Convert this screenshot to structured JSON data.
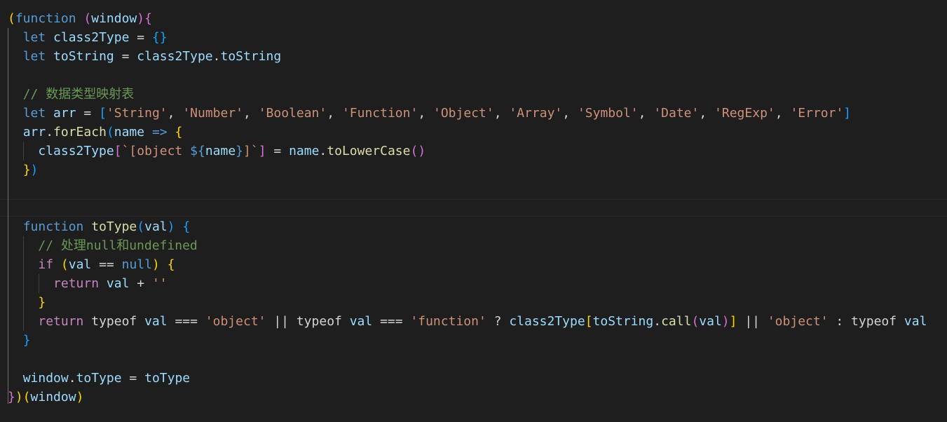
{
  "editor": {
    "lines": [
      [
        [
          "b1",
          "("
        ],
        [
          "kw",
          "function"
        ],
        [
          "op",
          " "
        ],
        [
          "b2",
          "("
        ],
        [
          "var",
          "window"
        ],
        [
          "b2",
          ")"
        ],
        [
          "b2",
          "{"
        ]
      ],
      [
        [
          "op",
          "  "
        ],
        [
          "kw",
          "let"
        ],
        [
          "op",
          " "
        ],
        [
          "var",
          "class2Type"
        ],
        [
          "op",
          " = "
        ],
        [
          "b3",
          "{}"
        ]
      ],
      [
        [
          "op",
          "  "
        ],
        [
          "kw",
          "let"
        ],
        [
          "op",
          " "
        ],
        [
          "var",
          "toString"
        ],
        [
          "op",
          " = "
        ],
        [
          "var",
          "class2Type"
        ],
        [
          "op",
          "."
        ],
        [
          "var",
          "toString"
        ]
      ],
      [],
      [
        [
          "op",
          "  "
        ],
        [
          "cm",
          "// 数据类型映射表"
        ]
      ],
      [
        [
          "op",
          "  "
        ],
        [
          "kw",
          "let"
        ],
        [
          "op",
          " "
        ],
        [
          "var",
          "arr"
        ],
        [
          "op",
          " = "
        ],
        [
          "b3",
          "["
        ],
        [
          "str",
          "'String'"
        ],
        [
          "op",
          ", "
        ],
        [
          "str",
          "'Number'"
        ],
        [
          "op",
          ", "
        ],
        [
          "str",
          "'Boolean'"
        ],
        [
          "op",
          ", "
        ],
        [
          "str",
          "'Function'"
        ],
        [
          "op",
          ", "
        ],
        [
          "str",
          "'Object'"
        ],
        [
          "op",
          ", "
        ],
        [
          "str",
          "'Array'"
        ],
        [
          "op",
          ", "
        ],
        [
          "str",
          "'Symbol'"
        ],
        [
          "op",
          ", "
        ],
        [
          "str",
          "'Date'"
        ],
        [
          "op",
          ", "
        ],
        [
          "str",
          "'RegExp'"
        ],
        [
          "op",
          ", "
        ],
        [
          "str",
          "'Error'"
        ],
        [
          "b3",
          "]"
        ]
      ],
      [
        [
          "op",
          "  "
        ],
        [
          "var",
          "arr"
        ],
        [
          "op",
          "."
        ],
        [
          "fn",
          "forEach"
        ],
        [
          "b3",
          "("
        ],
        [
          "var",
          "name"
        ],
        [
          "op",
          " "
        ],
        [
          "kw",
          "=>"
        ],
        [
          "op",
          " "
        ],
        [
          "b1",
          "{"
        ]
      ],
      [
        [
          "op",
          "    "
        ],
        [
          "var",
          "class2Type"
        ],
        [
          "b2",
          "["
        ],
        [
          "str",
          "`[object "
        ],
        [
          "kw",
          "${"
        ],
        [
          "var",
          "name"
        ],
        [
          "kw",
          "}"
        ],
        [
          "str",
          "]`"
        ],
        [
          "b2",
          "]"
        ],
        [
          "op",
          " = "
        ],
        [
          "var",
          "name"
        ],
        [
          "op",
          "."
        ],
        [
          "fn",
          "toLowerCase"
        ],
        [
          "b2",
          "()"
        ]
      ],
      [
        [
          "op",
          "  "
        ],
        [
          "b1",
          "}"
        ],
        [
          "b3",
          ")"
        ]
      ],
      [],
      [],
      [
        [
          "op",
          "  "
        ],
        [
          "kw",
          "function"
        ],
        [
          "op",
          " "
        ],
        [
          "fn",
          "toType"
        ],
        [
          "b3",
          "("
        ],
        [
          "var",
          "val"
        ],
        [
          "b3",
          ")"
        ],
        [
          "op",
          " "
        ],
        [
          "b3",
          "{"
        ]
      ],
      [
        [
          "op",
          "    "
        ],
        [
          "cm",
          "// 处理null和undefined"
        ]
      ],
      [
        [
          "op",
          "    "
        ],
        [
          "ctl",
          "if"
        ],
        [
          "op",
          " "
        ],
        [
          "b1",
          "("
        ],
        [
          "var",
          "val"
        ],
        [
          "op",
          " == "
        ],
        [
          "kw",
          "null"
        ],
        [
          "b1",
          ")"
        ],
        [
          "op",
          " "
        ],
        [
          "b1",
          "{"
        ]
      ],
      [
        [
          "op",
          "      "
        ],
        [
          "ctl",
          "return"
        ],
        [
          "op",
          " "
        ],
        [
          "var",
          "val"
        ],
        [
          "op",
          " + "
        ],
        [
          "str",
          "''"
        ]
      ],
      [
        [
          "op",
          "    "
        ],
        [
          "b1",
          "}"
        ]
      ],
      [
        [
          "op",
          "    "
        ],
        [
          "ctl",
          "return"
        ],
        [
          "op",
          " typeof "
        ],
        [
          "var",
          "val"
        ],
        [
          "op",
          " === "
        ],
        [
          "str",
          "'object'"
        ],
        [
          "op",
          " || typeof "
        ],
        [
          "var",
          "val"
        ],
        [
          "op",
          " === "
        ],
        [
          "str",
          "'function'"
        ],
        [
          "op",
          " ? "
        ],
        [
          "var",
          "class2Type"
        ],
        [
          "b1",
          "["
        ],
        [
          "var",
          "toString"
        ],
        [
          "op",
          "."
        ],
        [
          "fn",
          "call"
        ],
        [
          "b2",
          "("
        ],
        [
          "var",
          "val"
        ],
        [
          "b2",
          ")"
        ],
        [
          "b1",
          "]"
        ],
        [
          "op",
          " || "
        ],
        [
          "str",
          "'object'"
        ],
        [
          "op",
          " : typeof "
        ],
        [
          "var",
          "val"
        ]
      ],
      [
        [
          "op",
          "  "
        ],
        [
          "b3",
          "}"
        ]
      ],
      [],
      [
        [
          "op",
          "  "
        ],
        [
          "var",
          "window"
        ],
        [
          "op",
          "."
        ],
        [
          "var",
          "toType"
        ],
        [
          "op",
          " = "
        ],
        [
          "var",
          "toType"
        ]
      ],
      [
        [
          "b2",
          "}"
        ],
        [
          "b1",
          ")("
        ],
        [
          "var",
          "window"
        ],
        [
          "b1",
          ")"
        ]
      ]
    ]
  }
}
